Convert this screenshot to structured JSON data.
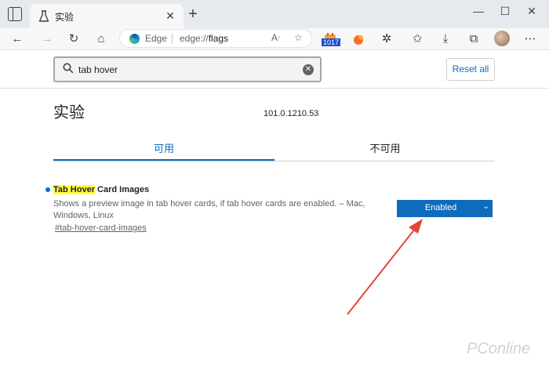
{
  "tab": {
    "title": "实验",
    "close_glyph": "✕"
  },
  "window_controls": {
    "minimize": "—",
    "maximize": "☐",
    "close": "✕"
  },
  "toolbar": {
    "omnibox_brand": "Edge",
    "url_scheme": "edge://",
    "url_path": "flags",
    "extension_badge": "1017"
  },
  "search": {
    "value": "tab hover",
    "reset_label": "Reset all"
  },
  "main": {
    "title": "实验",
    "version": "101.0.1210.53",
    "tabs": [
      {
        "label": "可用"
      },
      {
        "label": "不可用"
      }
    ]
  },
  "experiment": {
    "name_highlight": "Tab Hover",
    "name_rest": " Card Images",
    "description": "Shows a preview image in tab hover cards, if tab hover cards are enabled. – Mac, Windows, Linux",
    "link": "#tab-hover-card-images",
    "state": "Enabled"
  },
  "watermark": "PConline",
  "colors": {
    "accent": "#0f6cbd",
    "highlight": "#ffff3d",
    "annotation_arrow": "#e8443a"
  }
}
